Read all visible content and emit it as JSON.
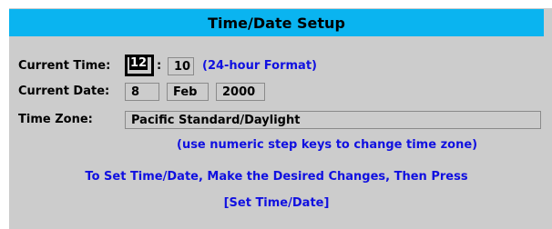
{
  "title": "Time/Date Setup",
  "time": {
    "label": "Current Time:",
    "hour": "12",
    "separator": ":",
    "minute": "10",
    "format_note": "(24-hour Format)"
  },
  "date": {
    "label": "Current Date:",
    "day": "8",
    "month": "Feb",
    "year": "2000"
  },
  "timezone": {
    "label": "Time Zone:",
    "value": "Pacific Standard/Daylight",
    "hint": "(use numeric step keys to change time zone)"
  },
  "instructions": {
    "line1": "To Set Time/Date, Make the Desired Changes, Then Press",
    "line2": "[Set Time/Date]"
  },
  "colors": {
    "title_bar": "#0ab4f0",
    "panel": "#cccccc",
    "hint_text": "#1010e0"
  }
}
